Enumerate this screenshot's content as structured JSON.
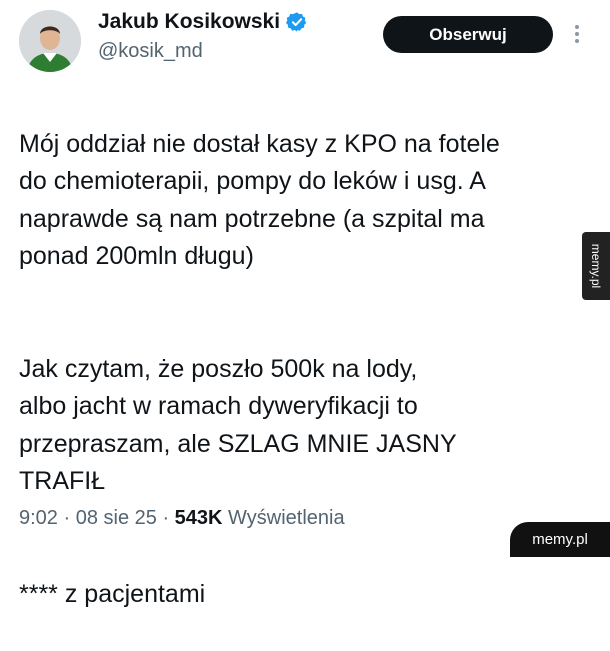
{
  "author": {
    "display_name": "Jakub Kosikowski",
    "handle": "@kosik_md",
    "verified": true
  },
  "follow_label": "Obserwuj",
  "tweet": {
    "paragraph1": "Mój oddział nie dostał kasy z KPO na fotele\ndo chemioterapii, pompy do leków i usg. A\nnaprawde są nam potrzebne (a szpital ma\nponad 200mln długu)",
    "paragraph2": "Jak czytam, że poszło 500k na lody,\nalbo jacht w ramach dyweryfikacji to\nprzepraszam, ale SZLAG MNIE JASNY\nTRAFIŁ",
    "paragraph3": "**** z pacjentami"
  },
  "meta": {
    "time": "9:02",
    "date": "08 sie 25",
    "views_count": "543K",
    "views_label": "Wyświetlenia"
  },
  "watermarks": {
    "side": "memy.pl",
    "bottom": "memy.pl"
  },
  "colors": {
    "verified_badge": "#1d9bf0",
    "button_bg": "#0f1419",
    "secondary_text": "#536471"
  }
}
